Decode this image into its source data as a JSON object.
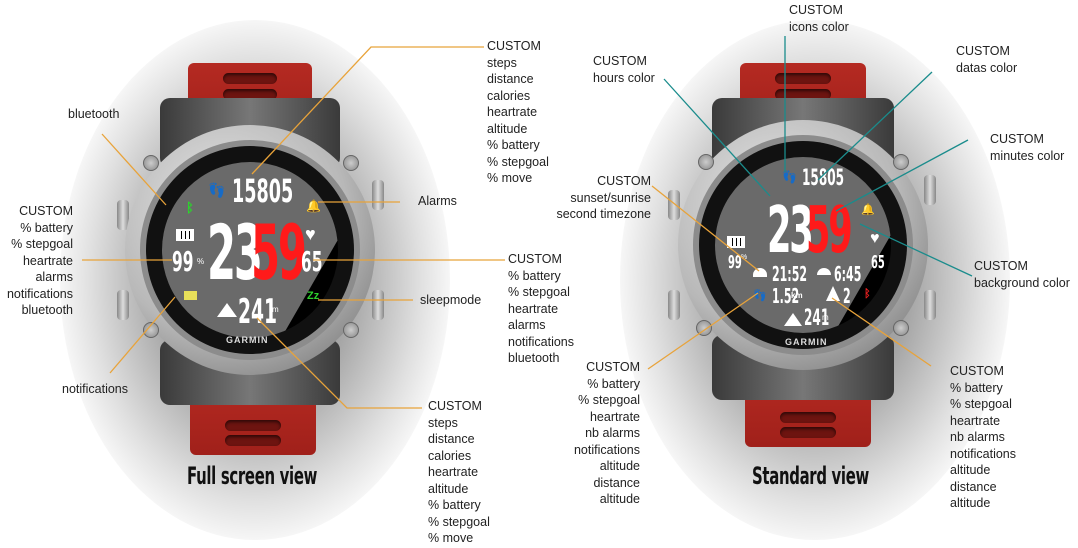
{
  "colors": {
    "orange_leader": "#e8a33a",
    "teal_leader": "#1a8c8c",
    "hours": "#ffffff",
    "minutes": "#ff1a1a",
    "green_icon": "#2ed12e",
    "notification_icon": "#e8e05a",
    "bt_red": "#e82020",
    "strap": "#b52a22"
  },
  "full_view": {
    "caption": "Full screen view",
    "watch": {
      "steps": "15805",
      "hours": "23",
      "minutes": "59",
      "battery_pct": "99",
      "battery_unit": "%",
      "heartrate": "65",
      "altitude": "241",
      "altitude_unit": "m",
      "brand": "GARMIN"
    },
    "labels": {
      "bluetooth": "bluetooth",
      "alarms": "Alarms",
      "sleepmode": "sleepmode",
      "notifications": "notifications",
      "top_right": [
        "CUSTOM",
        "steps",
        "distance",
        "calories",
        "heartrate",
        "altitude",
        "% battery",
        "% stepgoal",
        "% move"
      ],
      "left": [
        "CUSTOM",
        "% battery",
        "% stepgoal",
        "heartrate",
        "alarms",
        "notifications",
        "bluetooth"
      ],
      "right": [
        "CUSTOM",
        "% battery",
        "% stepgoal",
        "heartrate",
        "alarms",
        "notifications",
        "bluetooth"
      ],
      "bottom": [
        "CUSTOM",
        "steps",
        "distance",
        "calories",
        "heartrate",
        "altitude",
        "% battery",
        "% stepgoal",
        "% move"
      ]
    }
  },
  "standard_view": {
    "caption": "Standard view",
    "watch": {
      "steps": "15805",
      "hours": "23",
      "minutes": "59",
      "battery_pct": "99",
      "battery_unit": "%",
      "heartrate": "65",
      "sunset": "21:52",
      "sunrise": "6:45",
      "distance": "1.52",
      "distance_unit": "km",
      "alarms_count": "2",
      "altitude": "241",
      "altitude_unit": "m",
      "brand": "GARMIN"
    },
    "labels": {
      "icons_color": [
        "CUSTOM",
        "icons color"
      ],
      "hours_color": [
        "CUSTOM",
        "hours color"
      ],
      "datas_color": [
        "CUSTOM",
        "datas color"
      ],
      "minutes_color": [
        "CUSTOM",
        "minutes color"
      ],
      "sunset": [
        "CUSTOM",
        "sunset/sunrise",
        "second timezone"
      ],
      "background_color": [
        "CUSTOM",
        "background color"
      ],
      "bottom_left": [
        "CUSTOM",
        "% battery",
        "% stepgoal",
        "heartrate",
        "nb alarms",
        "notifications",
        "altitude",
        "distance",
        "altitude"
      ],
      "bottom_right": [
        "CUSTOM",
        "% battery",
        "% stepgoal",
        "heartrate",
        "nb alarms",
        "notifications",
        "altitude",
        "distance",
        "altitude"
      ]
    }
  }
}
